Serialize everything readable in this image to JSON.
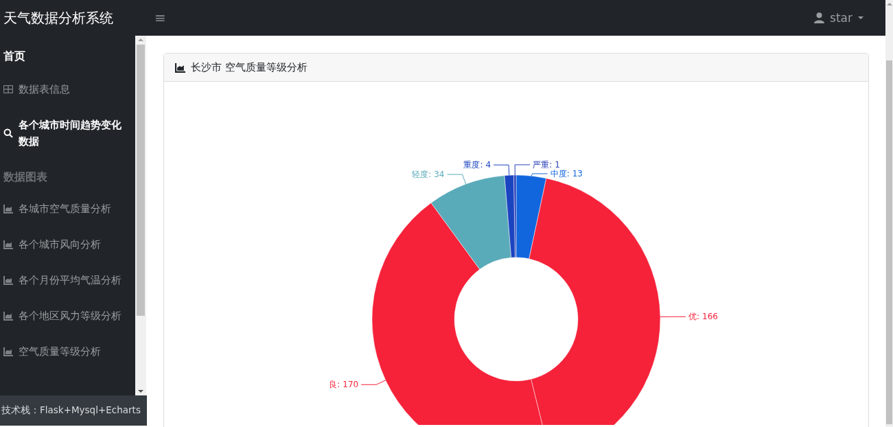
{
  "navbar": {
    "brand": "天气数据分析系统",
    "toggle": "≡",
    "user": "star"
  },
  "sidebar": {
    "items": [
      {
        "kind": "title",
        "label": "首页"
      },
      {
        "kind": "table",
        "label": "数据表信息",
        "selected": false
      },
      {
        "kind": "search",
        "label": "各个城市时间趋势变化数据",
        "selected": true
      },
      {
        "kind": "section",
        "label": "数据图表"
      },
      {
        "kind": "chart",
        "label": "各城市空气质量分析",
        "selected": false
      },
      {
        "kind": "chart",
        "label": "各个城市风向分析",
        "selected": false
      },
      {
        "kind": "chart",
        "label": "各个月份平均气温分析",
        "selected": false
      },
      {
        "kind": "chart",
        "label": "各个地区风力等级分析",
        "selected": false
      },
      {
        "kind": "chart",
        "label": "空气质量等级分析",
        "selected": false
      }
    ],
    "footer": "技术栈：Flask+Mysql+Echarts"
  },
  "card": {
    "title": "长沙市 空气质量等级分析",
    "chart_data": {
      "type": "donut",
      "categories": [
        "中度",
        "优",
        "良",
        "轻度",
        "重度",
        "严重"
      ],
      "series": [
        {
          "values": [
            13,
            166,
            170,
            34,
            4,
            1
          ]
        }
      ],
      "data_labels": true
    },
    "label_separators": [
      ":",
      ":",
      ":",
      ":",
      ":",
      ":"
    ]
  }
}
